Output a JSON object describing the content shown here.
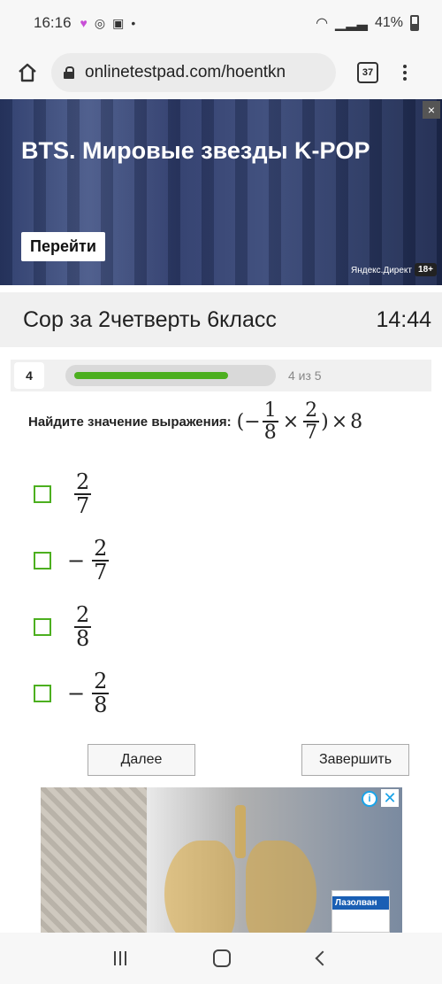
{
  "status_bar": {
    "time": "16:16",
    "battery": "41%"
  },
  "browser": {
    "url": "onlinetestpad.com/hoentkn",
    "tab_count": "37"
  },
  "top_ad": {
    "title": "BTS. Мировые звезды K-POP",
    "cta": "Перейти",
    "source": "Яндекс.Директ",
    "age": "18+",
    "close": "×"
  },
  "test": {
    "title": "Сор за 2четверть 6класс",
    "timer": "14:44",
    "question_number": "4",
    "progress_text": "4 из 5",
    "progress_fraction": 0.8,
    "accent_color": "#4caf1f"
  },
  "question": {
    "prompt": "Найдите значение выражения:",
    "expr": {
      "open": "(−",
      "f1_num": "1",
      "f1_den": "8",
      "times1": "×",
      "f2_num": "2",
      "f2_den": "7",
      "close": ")",
      "times2": "×",
      "last": "8"
    }
  },
  "options": [
    {
      "sign": "",
      "num": "2",
      "den": "7"
    },
    {
      "sign": "−",
      "num": "2",
      "den": "7"
    },
    {
      "sign": "",
      "num": "2",
      "den": "8"
    },
    {
      "sign": "−",
      "num": "2",
      "den": "8"
    }
  ],
  "buttons": {
    "next": "Далее",
    "finish": "Завершить"
  },
  "bottom_ad": {
    "info": "i",
    "close": "✕",
    "product": "Лазолван"
  }
}
